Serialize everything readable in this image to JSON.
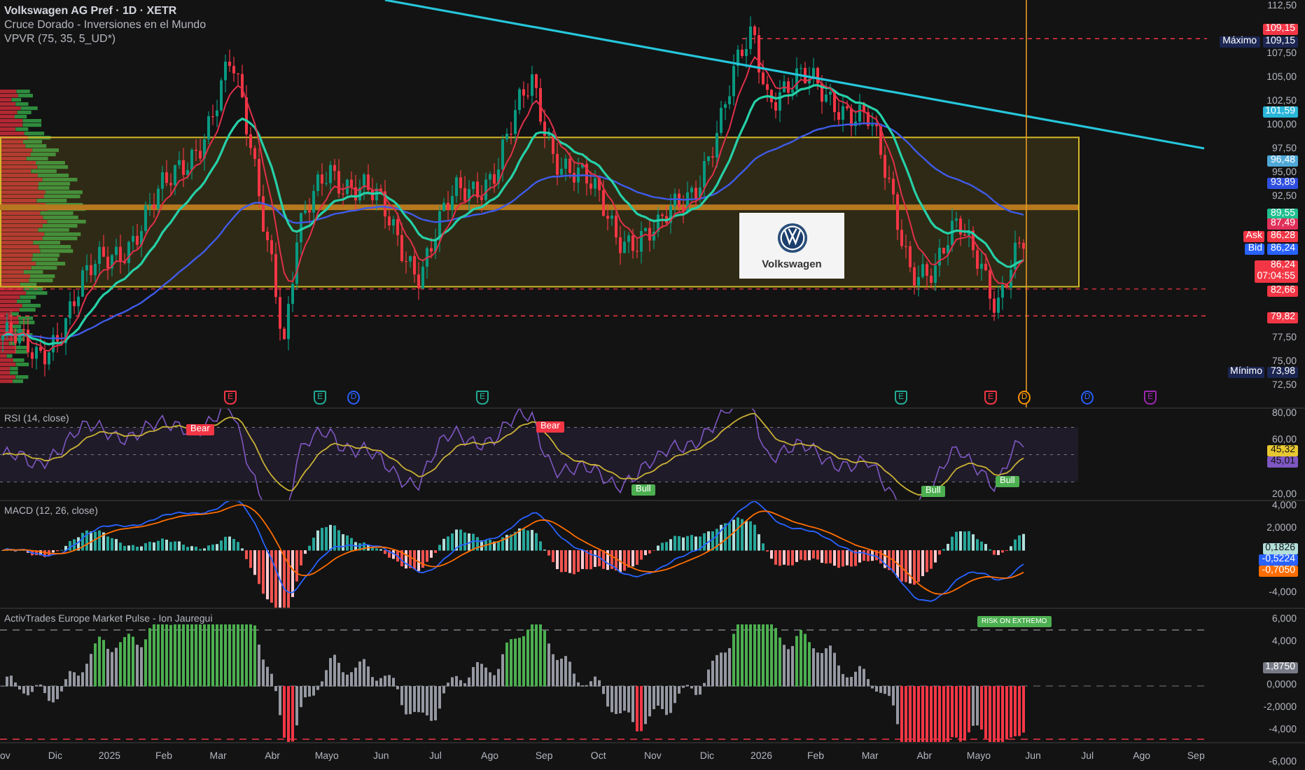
{
  "header": {
    "title": "Volkswagen AG Pref · 1D · XETR",
    "indicators": [
      "Cruce Dorado - Inversiones en el Mundo",
      "VPVR (75, 35, 5_UD*)"
    ]
  },
  "price_axis": {
    "ticks": [
      "112,50",
      "107,50",
      "105,00",
      "102,50",
      "100,00",
      "97,50",
      "95,00",
      "92,50",
      "77,50",
      "75,00",
      "72,50"
    ],
    "badges": [
      {
        "text": "109,15",
        "color": "#f23645"
      },
      {
        "prefix": "Máximo",
        "text": "109,15",
        "color": "#1c2652"
      },
      {
        "text": "101,59",
        "color": "#29b6d8"
      },
      {
        "text": "96,48",
        "color": "#4fa8d8"
      },
      {
        "text": "93,89",
        "color": "#2f4fe0"
      },
      {
        "text": "89,55",
        "color": "#1fbf8f"
      },
      {
        "text": "87,49",
        "color": "#e0305a"
      },
      {
        "prefix": "Ask",
        "text": "86,28",
        "color": "#f23645"
      },
      {
        "prefix": "Bid",
        "text": "86,24",
        "color": "#2962ff"
      },
      {
        "text": "86,24",
        "subtext": "07:04:55",
        "color": "#f23645"
      },
      {
        "text": "82,66",
        "color": "#f23645"
      },
      {
        "text": "79,82",
        "color": "#f23645"
      },
      {
        "prefix": "Mínimo",
        "text": "73,98",
        "color": "#1c2652"
      }
    ]
  },
  "logo_card": {
    "caption": "Volkswagen"
  },
  "events": [
    {
      "letter": "E",
      "kind": "earnings",
      "color": "#f23645"
    },
    {
      "letter": "E",
      "kind": "earnings",
      "color": "#22ab94"
    },
    {
      "letter": "D",
      "kind": "dividend",
      "color": "#2962ff"
    },
    {
      "letter": "E",
      "kind": "earnings",
      "color": "#22ab94"
    },
    {
      "letter": "E",
      "kind": "earnings",
      "color": "#22ab94"
    },
    {
      "letter": "E",
      "kind": "earnings",
      "color": "#f23645"
    },
    {
      "letter": "D",
      "kind": "dividend",
      "color": "#ff9800"
    },
    {
      "letter": "D",
      "kind": "dividend",
      "color": "#2962ff"
    },
    {
      "letter": "E",
      "kind": "earnings",
      "color": "#9c27b0"
    }
  ],
  "rsi": {
    "title": "RSI (14, close)",
    "ticks": [
      "80,00",
      "60,00",
      "20,00"
    ],
    "badges": [
      {
        "text": "45,32",
        "color": "#e8c830"
      },
      {
        "text": "45,01",
        "color": "#7e57c2"
      }
    ],
    "signals": [
      {
        "label": "Bear",
        "kind": "bear"
      },
      {
        "label": "Bear",
        "kind": "bear"
      },
      {
        "label": "Bull",
        "kind": "bull"
      },
      {
        "label": "Bull",
        "kind": "bull"
      },
      {
        "label": "Bull",
        "kind": "bull"
      }
    ]
  },
  "macd": {
    "title": "MACD (12, 26, close)",
    "ticks": [
      "4,000",
      "2,0000",
      "-4,000"
    ],
    "badges": [
      {
        "text": "0,1826",
        "color": "#b2dfdb"
      },
      {
        "text": "-0,5224",
        "color": "#2962ff"
      },
      {
        "text": "-0,7050",
        "color": "#ff6d00"
      }
    ]
  },
  "market_pulse": {
    "title": "ActivTrades Europe Market Pulse - Ion Jauregui",
    "ticks": [
      "6,000",
      "4,000",
      "0,0000",
      "-2,0000",
      "-4,000",
      "-6,000"
    ],
    "badges": [
      {
        "text": "1,8750",
        "color": "#787b86"
      }
    ],
    "signal": "RISK ON EXTREMO"
  },
  "time_axis": {
    "labels": [
      "ov",
      "Dic",
      "2025",
      "Feb",
      "Mar",
      "Abr",
      "Mayo",
      "Jun",
      "Jul",
      "Ago",
      "Sep",
      "Oct",
      "Nov",
      "Dic",
      "2026",
      "Feb",
      "Mar",
      "Abr",
      "Mayo",
      "Jun",
      "Jul",
      "Ago",
      "Sep"
    ]
  }
}
